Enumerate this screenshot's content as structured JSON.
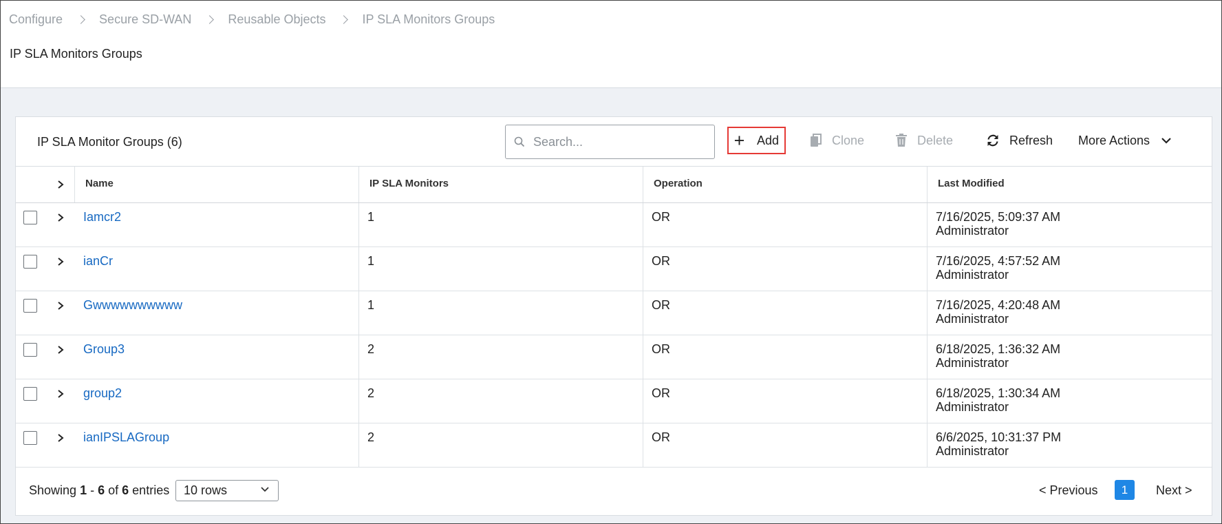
{
  "breadcrumb": [
    "Configure",
    "Secure SD-WAN",
    "Reusable Objects",
    "IP SLA Monitors Groups"
  ],
  "page_title": "IP SLA Monitors Groups",
  "toolbar": {
    "title": "IP SLA Monitor Groups (6)",
    "search_placeholder": "Search...",
    "add_label": "Add",
    "clone_label": "Clone",
    "delete_label": "Delete",
    "refresh_label": "Refresh",
    "more_actions_label": "More Actions"
  },
  "table": {
    "columns": [
      "Name",
      "IP SLA Monitors",
      "Operation",
      "Last Modified"
    ],
    "rows": [
      {
        "name": "Iamcr2",
        "monitors": "1",
        "operation": "OR",
        "modified": "7/16/2025, 5:09:37 AM",
        "user": "Administrator"
      },
      {
        "name": "ianCr",
        "monitors": "1",
        "operation": "OR",
        "modified": "7/16/2025, 4:57:52 AM",
        "user": "Administrator"
      },
      {
        "name": "Gwwwwwwwwww",
        "monitors": "1",
        "operation": "OR",
        "modified": "7/16/2025, 4:20:48 AM",
        "user": "Administrator"
      },
      {
        "name": "Group3",
        "monitors": "2",
        "operation": "OR",
        "modified": "6/18/2025, 1:36:32 AM",
        "user": "Administrator"
      },
      {
        "name": "group2",
        "monitors": "2",
        "operation": "OR",
        "modified": "6/18/2025, 1:30:34 AM",
        "user": "Administrator"
      },
      {
        "name": "ianIPSLAGroup",
        "monitors": "2",
        "operation": "OR",
        "modified": "6/6/2025, 10:31:37 PM",
        "user": "Administrator"
      }
    ]
  },
  "footer": {
    "showing_prefix": "Showing",
    "range_start": "1",
    "range_end": "6",
    "of_word": "of",
    "total": "6",
    "entries_word": "entries",
    "rows_per_page": "10 rows",
    "prev_label": "< Previous",
    "current_page": "1",
    "next_label": "Next >"
  },
  "colors": {
    "link": "#1769c2",
    "accent": "#1f87e5",
    "highlight_border": "#e53935"
  }
}
